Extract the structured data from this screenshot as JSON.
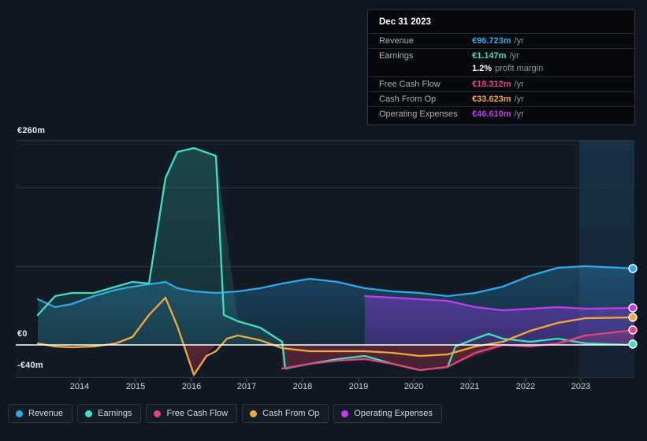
{
  "axis": {
    "y_labels": {
      "top": "€260m",
      "zero": "€0",
      "bottom": "-€40m"
    },
    "x_labels": [
      "2014",
      "2015",
      "2016",
      "2017",
      "2018",
      "2019",
      "2020",
      "2021",
      "2022",
      "2023"
    ]
  },
  "tooltip": {
    "title": "Dec 31 2023",
    "rows": [
      {
        "label": "Revenue",
        "value": "€96.723m",
        "unit": "/yr",
        "color": "#2fa8e8"
      },
      {
        "label": "Earnings",
        "value": "€1.147m",
        "unit": "/yr",
        "color": "#3ee0bd"
      },
      {
        "label": "Free Cash Flow",
        "value": "€18.312m",
        "unit": "/yr",
        "color": "#e0457b"
      },
      {
        "label": "Cash From Op",
        "value": "€33.623m",
        "unit": "/yr",
        "color": "#f0a93c"
      },
      {
        "label": "Operating Expenses",
        "value": "€46.610m",
        "unit": "/yr",
        "color": "#c03ce8"
      }
    ],
    "margin": {
      "value": "1.2%",
      "text": "profit margin"
    }
  },
  "legend": [
    {
      "label": "Revenue",
      "color": "#2fa8e8"
    },
    {
      "label": "Earnings",
      "color": "#3ee0bd"
    },
    {
      "label": "Free Cash Flow",
      "color": "#e0457b"
    },
    {
      "label": "Cash From Op",
      "color": "#f0a93c"
    },
    {
      "label": "Operating Expenses",
      "color": "#c03ce8"
    }
  ],
  "chart_data": {
    "type": "area",
    "title": "",
    "xlabel": "",
    "ylabel": "",
    "currency": "EUR",
    "units": "millions",
    "ylim": [
      -40,
      260
    ],
    "xlim": [
      2013.5,
      2024.0
    ],
    "grid": true,
    "gridlines": [
      260,
      200,
      100,
      0,
      -40
    ],
    "zero_line": 0,
    "legend_position": "bottom",
    "forecast_region": {
      "start": 2023.0,
      "end": 2024.0
    },
    "x": [
      2013.6,
      2013.9,
      2014.2,
      2014.6,
      2015.0,
      2015.3,
      2015.6,
      2015.9,
      2016.1,
      2016.4,
      2016.8,
      2017.2,
      2017.6,
      2018.0,
      2018.5,
      2019.0,
      2019.5,
      2020.0,
      2020.5,
      2021.0,
      2021.5,
      2022.0,
      2022.5,
      2023.0,
      2023.5,
      2024.0
    ],
    "series": [
      {
        "name": "Revenue",
        "color": "#2fa8e8",
        "values": [
          58,
          48,
          52,
          62,
          70,
          74,
          77,
          80,
          72,
          68,
          66,
          68,
          72,
          78,
          84,
          80,
          72,
          68,
          66,
          62,
          66,
          74,
          88,
          98,
          100,
          96.723
        ]
      },
      {
        "name": "Earnings",
        "color": "#3ee0bd",
        "values": [
          38,
          62,
          66,
          66,
          74,
          80,
          78,
          212,
          245,
          250,
          240,
          30,
          22,
          4,
          -28,
          -18,
          -14,
          -24,
          -32,
          -28,
          -26,
          8,
          22,
          6,
          0,
          1.147
        ]
      },
      {
        "name": "Free Cash Flow",
        "color": "#e0457b",
        "values": [
          null,
          null,
          null,
          null,
          null,
          null,
          null,
          null,
          null,
          null,
          null,
          null,
          null,
          -30,
          -24,
          -20,
          -14,
          -24,
          -32,
          -26,
          -10,
          -2,
          6,
          12,
          18,
          18.312
        ]
      },
      {
        "name": "Cash From Op",
        "color": "#f0a93c",
        "values": [
          2,
          -2,
          -3,
          -2,
          2,
          10,
          38,
          60,
          24,
          -10,
          -38,
          -8,
          2,
          2,
          -4,
          -8,
          -8,
          -8,
          -12,
          -10,
          -2,
          2,
          14,
          26,
          32,
          33.623
        ]
      },
      {
        "name": "Operating Expenses",
        "color": "#c03ce8",
        "values": [
          null,
          null,
          null,
          null,
          null,
          null,
          null,
          null,
          null,
          null,
          null,
          null,
          null,
          null,
          null,
          62,
          60,
          58,
          56,
          48,
          44,
          46,
          48,
          46,
          46,
          46.61
        ]
      }
    ]
  }
}
